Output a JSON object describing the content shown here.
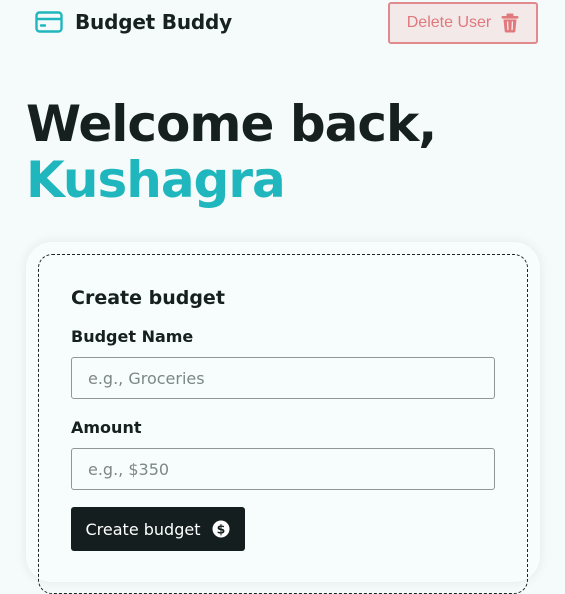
{
  "header": {
    "brand_title": "Budget Buddy",
    "brand_icon": "credit-card-icon",
    "delete_label": "Delete User",
    "delete_icon": "trash-icon"
  },
  "welcome": {
    "line1": "Welcome back,",
    "name": "Kushagra"
  },
  "form": {
    "title": "Create budget",
    "name_label": "Budget Name",
    "name_placeholder": "e.g., Groceries",
    "name_value": "",
    "amount_label": "Amount",
    "amount_placeholder": "e.g., $350",
    "amount_value": "",
    "submit_label": "Create budget",
    "submit_icon": "dollar-circle-icon"
  },
  "colors": {
    "accent": "#20b6bd",
    "danger": "#e0787c",
    "dark": "#141e1e",
    "background": "#f5fbfb"
  }
}
